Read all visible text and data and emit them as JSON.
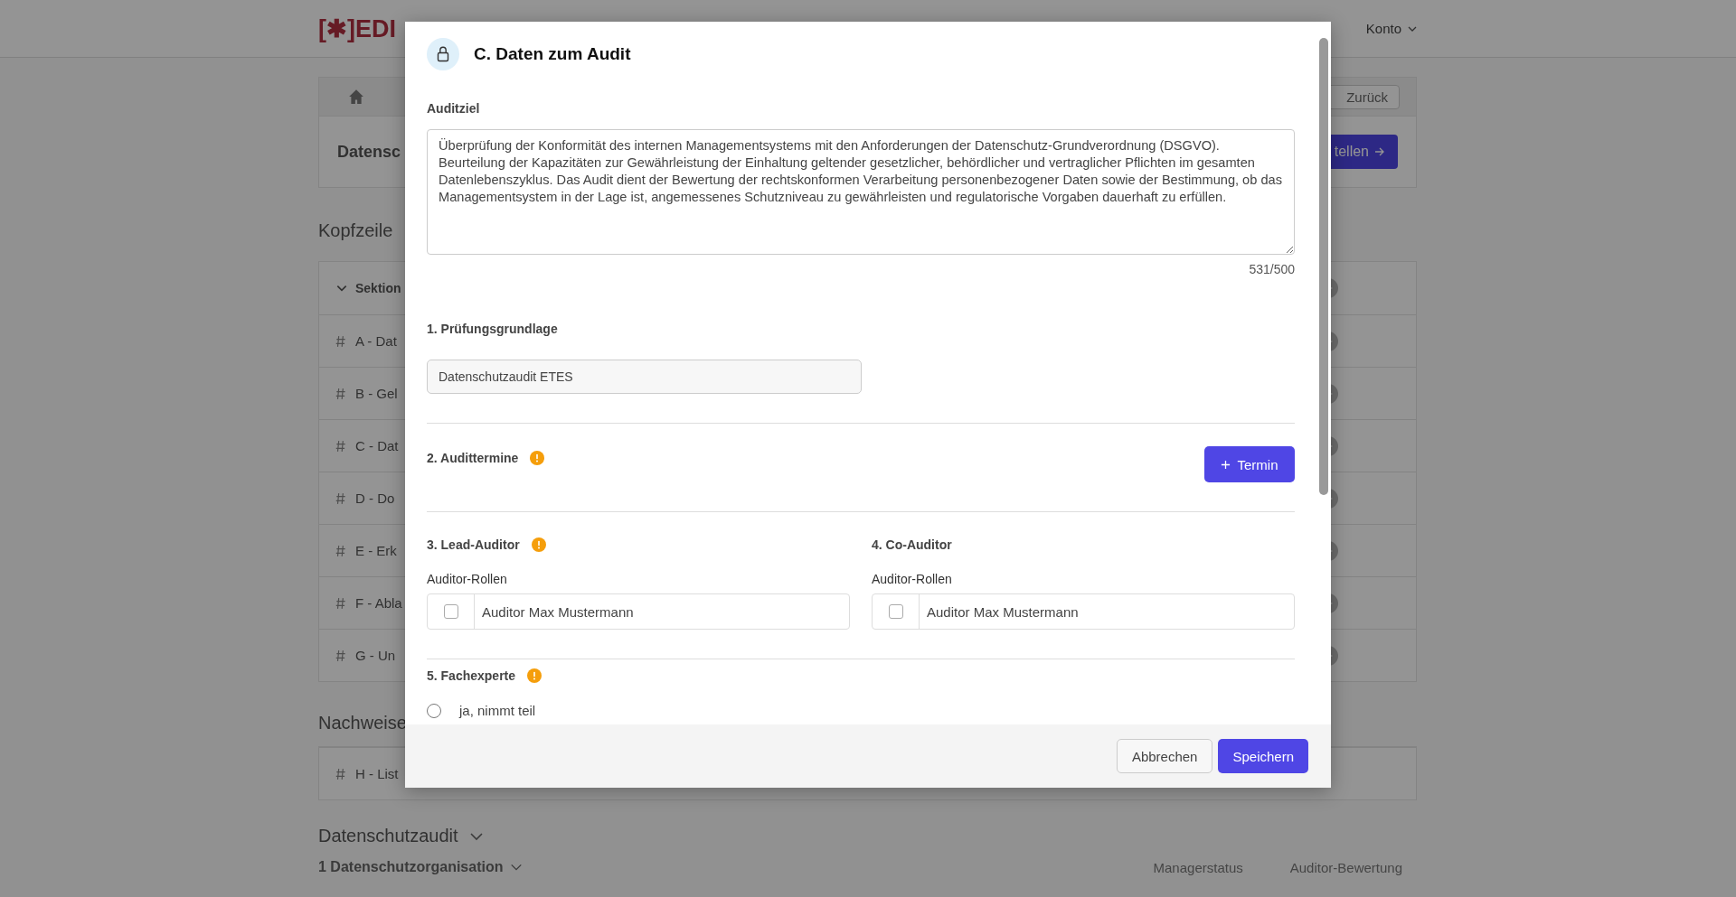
{
  "page": {
    "logo": "[✱]EDI",
    "account_menu": "Konto",
    "back_button": "Zurück",
    "title": "Datensc",
    "primary_button": "tellen",
    "header_heading": "Kopfzeile",
    "sections_header": "Sektion",
    "sections": [
      "A - Dat",
      "B - Gel",
      "C - Dat",
      "D - Do",
      "E - Erk",
      "F - Abla",
      "G - Un"
    ],
    "evidence_heading": "Nachweise",
    "evidence": [
      "H - List"
    ],
    "audit_heading": "Datenschutzaudit",
    "subheading": "1 Datenschutzorganisation",
    "columns": [
      "Managerstatus",
      "Auditor-Bewertung"
    ]
  },
  "dialog": {
    "title": "C. Daten zum Audit",
    "goal": {
      "label": "Auditziel",
      "value": "Überprüfung der Konformität des internen Managementsystems mit den Anforderungen der Datenschutz-Grundverordnung (DSGVO). Beurteilung der Kapazitäten zur Gewährleistung der Einhaltung geltender gesetzlicher, behördlicher und vertraglicher Pflichten im gesamten Datenlebenszyklus. Das Audit dient der Bewertung der rechtskonformen Verarbeitung personenbezogener Daten sowie der Bestimmung, ob das Managementsystem in der Lage ist, angemessenes Schutzniveau zu gewährleisten und regulatorische Vorgaben dauerhaft zu erfüllen.",
      "counter": "531/500"
    },
    "basis": {
      "label": "1. Prüfungsgrundlage",
      "value": "Datenschutzaudit ETES"
    },
    "dates": {
      "label": "2. Audittermine",
      "warning": true,
      "button": "Termin"
    },
    "auditors": [
      {
        "label": "3. Lead-Auditor",
        "warning": true,
        "roles_label": "Auditor-Rollen",
        "option": "Auditor Max Mustermann",
        "checked": false
      },
      {
        "label": "4. Co-Auditor",
        "warning": false,
        "roles_label": "Auditor-Rollen",
        "option": "Auditor Max Mustermann",
        "checked": false
      }
    ],
    "expert": {
      "label": "5. Fachexperte",
      "warning": true,
      "options": [
        {
          "label": "ja, nimmt teil",
          "selected": false
        }
      ]
    },
    "buttons": {
      "cancel": "Abbrechen",
      "save": "Speichern"
    }
  }
}
